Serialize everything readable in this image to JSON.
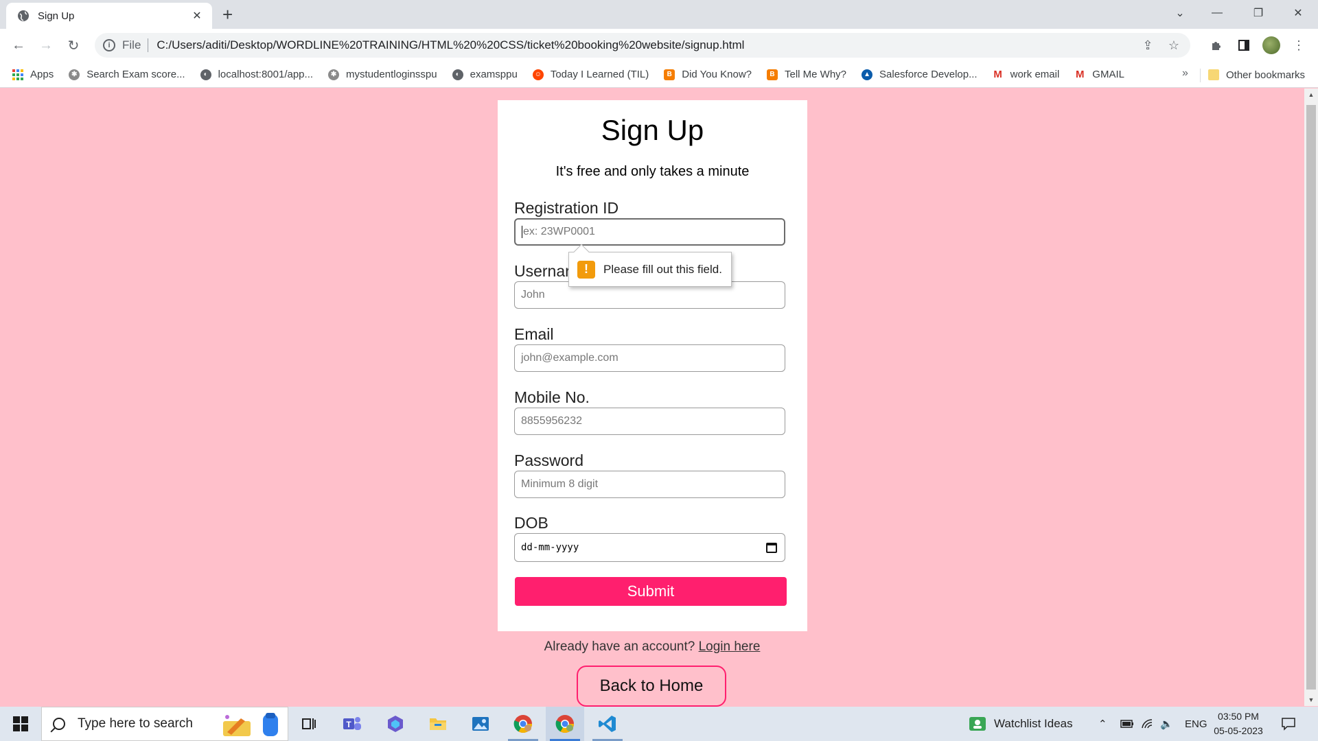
{
  "browser": {
    "tab_title": "Sign Up",
    "url_scheme": "File",
    "url": "C:/Users/aditi/Desktop/WORDLINE%20TRAINING/HTML%20%20CSS/ticket%20booking%20website/signup.html",
    "bookmarks": [
      {
        "label": "Apps",
        "icon": "apps-grid-icon",
        "color": "#4285f4"
      },
      {
        "label": "Search Exam score...",
        "icon": "bookmark-site-icon",
        "color": "#6d6d6d"
      },
      {
        "label": "localhost:8001/app...",
        "icon": "globe-icon",
        "color": "#5f6368"
      },
      {
        "label": "mystudentloginsspu",
        "icon": "bookmark-site-icon",
        "color": "#6d6d6d"
      },
      {
        "label": "examsppu",
        "icon": "globe-icon",
        "color": "#5f6368"
      },
      {
        "label": "Today I Learned (TIL)",
        "icon": "reddit-icon",
        "color": "#ff4500"
      },
      {
        "label": "Did You Know?",
        "icon": "blogger-icon",
        "color": "#f57d00"
      },
      {
        "label": "Tell Me Why?",
        "icon": "blogger-icon",
        "color": "#f57d00"
      },
      {
        "label": "Salesforce Develop...",
        "icon": "trailhead-icon",
        "color": "#0b5cab"
      },
      {
        "label": "work email",
        "icon": "gmail-icon",
        "color": "#d93025"
      },
      {
        "label": "GMAIL",
        "icon": "gmail-icon",
        "color": "#d93025"
      }
    ],
    "bookmarks_more": "»",
    "other_bookmarks": "Other bookmarks"
  },
  "page": {
    "title": "Sign Up",
    "subtitle": "It's free and only takes a minute",
    "fields": [
      {
        "label": "Registration ID",
        "placeholder": "ex: 23WP0001"
      },
      {
        "label": "Usernar",
        "placeholder": "John"
      },
      {
        "label": "Email",
        "placeholder": "john@example.com"
      },
      {
        "label": "Mobile No.",
        "placeholder": "8855956232"
      },
      {
        "label": "Password",
        "placeholder": "Minimum 8 digit"
      },
      {
        "label": "DOB",
        "placeholder": "dd-mm-yyyy"
      }
    ],
    "submit_label": "Submit",
    "validation_tooltip": "Please fill out this field.",
    "login_prompt": "Already have an account?",
    "login_link": "Login here",
    "back_home": "Back to Home",
    "accent_color": "#ff1f6e",
    "background_color": "#ffc0cb"
  },
  "taskbar": {
    "search_placeholder": "Type here to search",
    "apps": [
      "task-view",
      "teams",
      "copilot",
      "file-explorer",
      "photos",
      "chrome",
      "chrome-profile",
      "vscode"
    ],
    "widget_label": "Watchlist Ideas",
    "language": "ENG",
    "time": "03:50 PM",
    "date": "05-05-2023"
  }
}
